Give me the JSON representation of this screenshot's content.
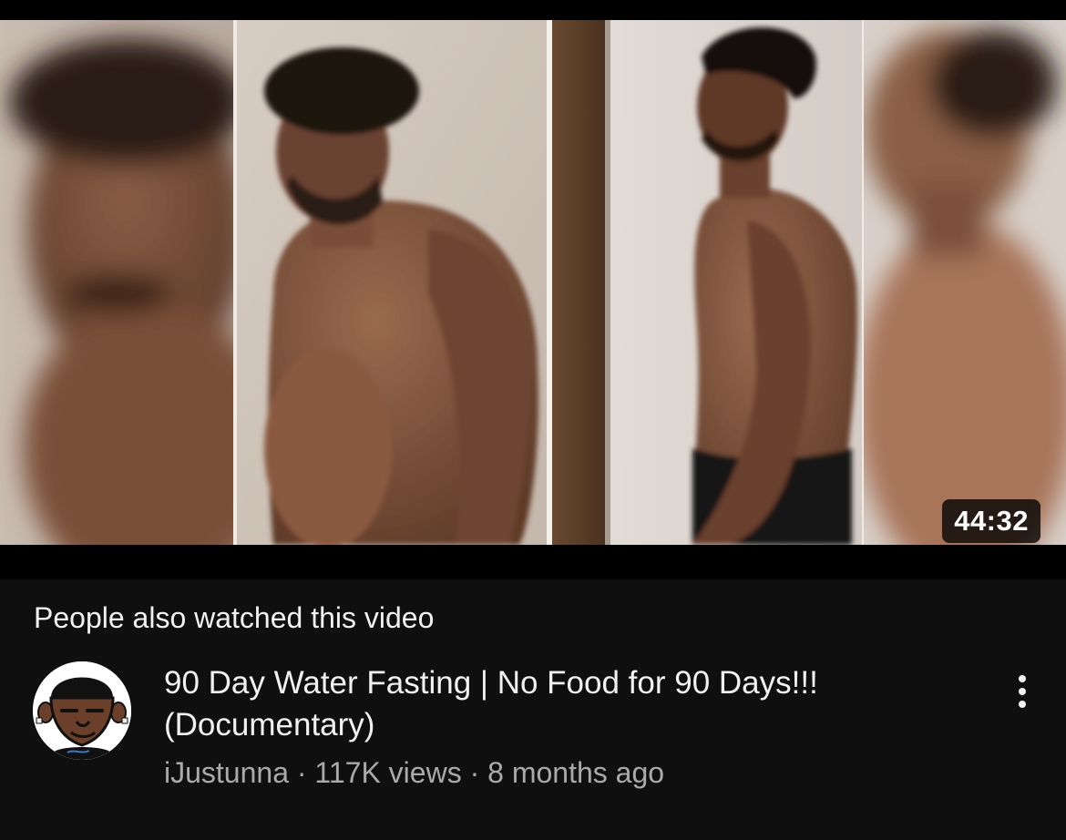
{
  "thumbnail": {
    "duration": "44:32",
    "content": "before-and-after side-profile photos of a man"
  },
  "section": {
    "label": "People also watched this video"
  },
  "video": {
    "title": "90 Day Water Fasting | No Food for 90 Days!!! (Documentary)",
    "channel": "iJustunna",
    "separator": " · ",
    "views": "117K views",
    "age": "8 months ago"
  },
  "icons": {
    "more": "vertical-ellipsis-icon",
    "avatar": "cartoon-avatar-icon"
  },
  "colors": {
    "background": "#0f0f0f",
    "primary_text": "#f1f1f1",
    "secondary_text": "#aaaaaa",
    "badge_bg": "#000000"
  }
}
